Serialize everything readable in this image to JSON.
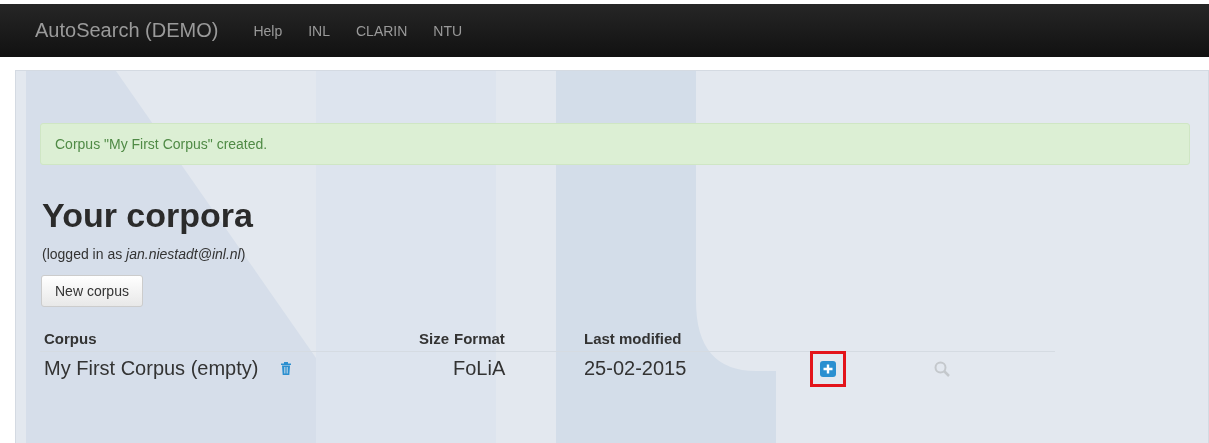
{
  "navbar": {
    "brand": "AutoSearch (DEMO)",
    "links": [
      "Help",
      "INL",
      "CLARIN",
      "NTU"
    ]
  },
  "alert": "Corpus \"My First Corpus\" created.",
  "heading": "Your corpora",
  "login_note": "(logged in as *jan.niestadt@inl.nl*)",
  "new_button": "New corpus",
  "table": {
    "columns": [
      "Corpus",
      "Size",
      "Format",
      "Last modified"
    ],
    "rows": [
      {
        "name": "My First Corpus (empty)",
        "size": "",
        "format": "FoLiA",
        "modified": "25-02-2015",
        "highlighted": true
      }
    ]
  }
}
